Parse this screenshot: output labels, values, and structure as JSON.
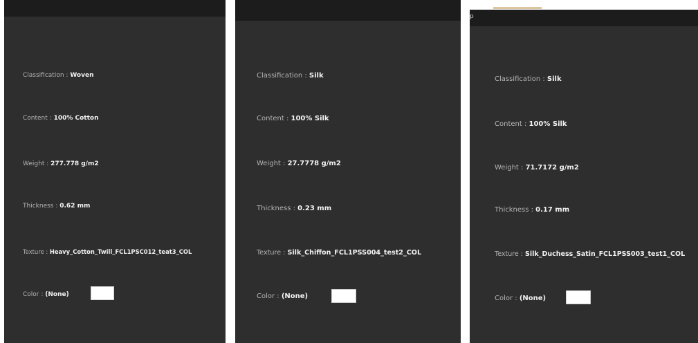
{
  "panels": [
    {
      "classification": {
        "label": "Classification : ",
        "value": "Woven"
      },
      "content": {
        "label": "Content : ",
        "value": "100% Cotton"
      },
      "weight": {
        "label": "Weight : ",
        "value": "277.778 g/m2"
      },
      "thickness": {
        "label": "Thickness : ",
        "value": "0.62 mm"
      },
      "texture": {
        "label": "Texture : ",
        "value": "Heavy_Cotton_Twill_FCL1PSC012_teat3_COL"
      },
      "color": {
        "label": "Color : ",
        "value": "(None)",
        "swatch": "#ffffff"
      }
    },
    {
      "classification": {
        "label": "Classification : ",
        "value": "Silk"
      },
      "content": {
        "label": "Content : ",
        "value": "100% Silk"
      },
      "weight": {
        "label": "Weight : ",
        "value": "27.7778 g/m2"
      },
      "thickness": {
        "label": "Thickness : ",
        "value": "0.23 mm"
      },
      "texture": {
        "label": "Texture : ",
        "value": "Silk_Chiffon_FCL1PSS004_test2_COL"
      },
      "color": {
        "label": "Color : ",
        "value": "(None)",
        "swatch": "#ffffff"
      }
    },
    {
      "header_stub": "p",
      "classification": {
        "label": "Classification : ",
        "value": "Silk"
      },
      "content": {
        "label": "Content : ",
        "value": "100% Silk"
      },
      "weight": {
        "label": "Weight : ",
        "value": "71.7172 g/m2"
      },
      "thickness": {
        "label": "Thickness : ",
        "value": "0.17 mm"
      },
      "texture": {
        "label": "Texture : ",
        "value": "Silk_Duchess_Satin_FCL1PSS003_test1_COL"
      },
      "color": {
        "label": "Color : ",
        "value": "(None)",
        "swatch": "#ffffff"
      }
    }
  ],
  "colors": {
    "panel_bg": "#2e2e2e",
    "header_bg": "#1c1c1c",
    "label": "#b4b4b4",
    "value": "#f2f2f2",
    "page_bg": "#ffffff"
  }
}
